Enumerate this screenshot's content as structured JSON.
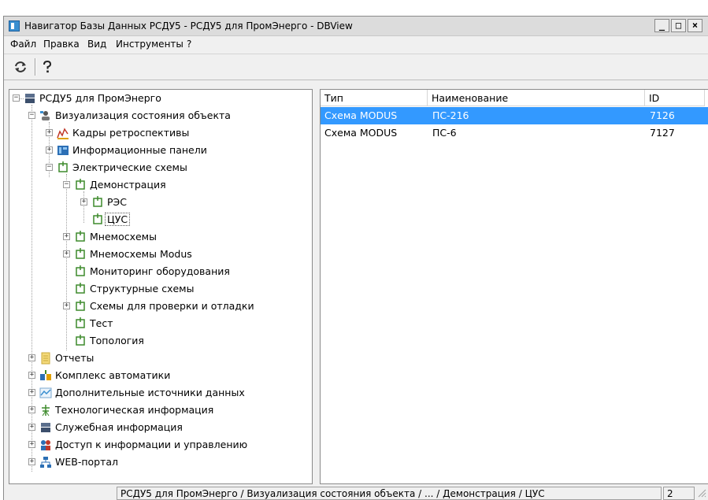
{
  "window": {
    "title": "Навигатор Базы Данных РСДУ5 - РСДУ5 для ПромЭнерго - DBView"
  },
  "window_buttons": {
    "minimize": "_",
    "maximize": "□",
    "close": "×"
  },
  "menu": [
    {
      "label": "Файл"
    },
    {
      "label": "Правка"
    },
    {
      "label": "Вид"
    },
    {
      "label": "Инструменты"
    },
    {
      "label": "?"
    }
  ],
  "toolbar": {
    "refresh_icon": "refresh-icon",
    "help_icon": "help-icon"
  },
  "tree": {
    "root": "РСДУ5 для ПромЭнерго",
    "visualization": "Визуализация состояния объекта",
    "retro": "Кадры ретроспективы",
    "info_panels": "Информационные панели",
    "el_schemes": "Электрические схемы",
    "demo": "Демонстрация",
    "res": "РЭС",
    "cus": "ЦУС",
    "mnemo": "Мнемосхемы",
    "mnemo_modus": "Мнемосхемы Modus",
    "monitoring": "Мониторинг оборудования",
    "struct": "Структурные схемы",
    "check": "Схемы для проверки и отладки",
    "test": "Тест",
    "topology": "Топология",
    "reports": "Отчеты",
    "automation": "Комплекс автоматики",
    "extra_sources": "Дополнительные источники данных",
    "tech_info": "Технологическая информация",
    "service_info": "Служебная информация",
    "access": "Доступ к информации и управлению",
    "web": "WEB-портал"
  },
  "list": {
    "columns": [
      "Тип",
      "Наименование",
      "ID"
    ],
    "rows": [
      {
        "type": "Схема MODUS",
        "name": "ПС-216",
        "id": "7126",
        "selected": true
      },
      {
        "type": "Схема MODUS",
        "name": "ПС-6",
        "id": "7127",
        "selected": false
      }
    ]
  },
  "statusbar": {
    "path": "РСДУ5 для ПромЭнерго / Визуализация состояния объекта / ... / Демонстрация / ЦУС",
    "count": "2"
  },
  "colors": {
    "selection": "#3399ff",
    "titlebar": "#dcdcdc",
    "window_bg": "#f0f0f0"
  }
}
